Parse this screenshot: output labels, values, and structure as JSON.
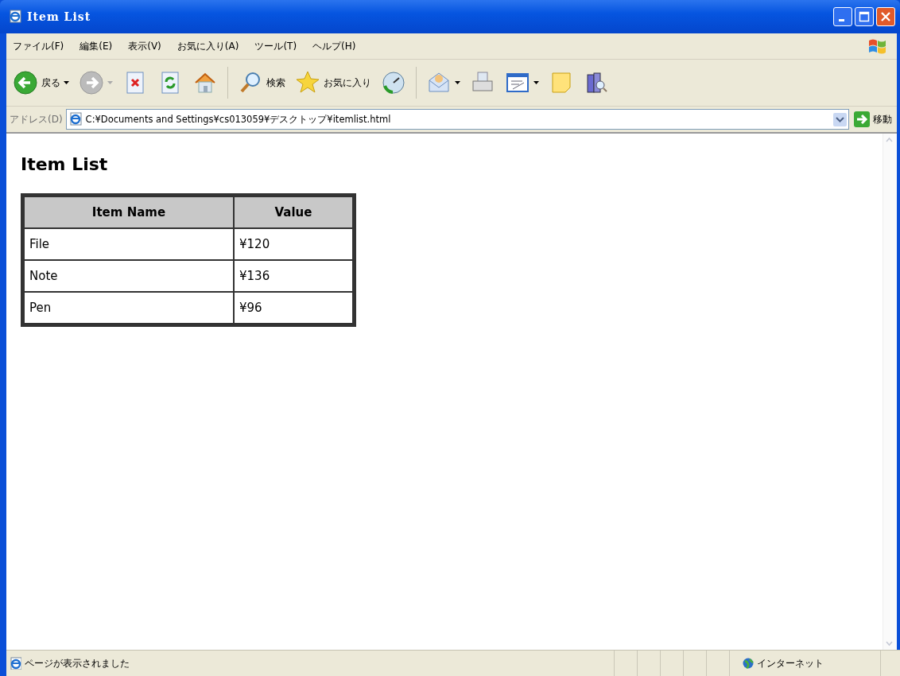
{
  "window": {
    "title": "Item List"
  },
  "menu": [
    "ファイル(F)",
    "編集(E)",
    "表示(V)",
    "お気に入り(A)",
    "ツール(T)",
    "ヘルプ(H)"
  ],
  "toolbar": [
    {
      "kind": "back",
      "label": "戻る",
      "disabled": false
    },
    {
      "kind": "forward",
      "disabled": true
    },
    {
      "kind": "stop"
    },
    {
      "kind": "refresh"
    },
    {
      "kind": "home"
    },
    {
      "kind": "sep"
    },
    {
      "kind": "search",
      "label": "検索"
    },
    {
      "kind": "favorites",
      "label": "お気に入り"
    },
    {
      "kind": "history"
    },
    {
      "kind": "sep"
    },
    {
      "kind": "mail"
    },
    {
      "kind": "print"
    },
    {
      "kind": "edit"
    },
    {
      "kind": "note"
    },
    {
      "kind": "research"
    }
  ],
  "address": {
    "label": "アドレス(D)",
    "value": "C:¥Documents and Settings¥cs013059¥デスクトップ¥itemlist.html",
    "go": "移動"
  },
  "page": {
    "heading": "Item List",
    "table": {
      "columns": [
        "Item Name",
        "Value"
      ],
      "rows": [
        [
          "File",
          "¥120"
        ],
        [
          "Note",
          "¥136"
        ],
        [
          "Pen",
          "¥96"
        ]
      ]
    }
  },
  "status_bar": {
    "text": "ページが表示されました",
    "zone": "インターネット"
  }
}
